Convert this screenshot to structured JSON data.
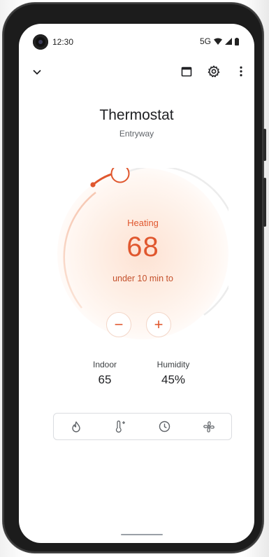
{
  "status_bar": {
    "time": "12:30",
    "network": "5G",
    "icons": [
      "wifi-icon",
      "signal-icon",
      "battery-icon"
    ]
  },
  "app_bar": {
    "left_icon": "chevron-down-icon",
    "right_icons": [
      "calendar-icon",
      "settings-icon",
      "more-vert-icon"
    ]
  },
  "header": {
    "title": "Thermostat",
    "subtitle": "Entryway"
  },
  "dial": {
    "mode_label": "Heating",
    "setpoint": "68",
    "status_text": "under 10 min to",
    "decrease_label": "−",
    "increase_label": "+"
  },
  "readings": {
    "indoor_label": "Indoor",
    "indoor_value": "65",
    "humidity_label": "Humidity",
    "humidity_value": "45%"
  },
  "mode_bar": {
    "items": [
      "flame-icon",
      "thermometer-plus-icon",
      "clock-icon",
      "fan-icon"
    ]
  },
  "colors": {
    "accent": "#e0572e",
    "text_primary": "#202124",
    "text_secondary": "#5f6368"
  }
}
